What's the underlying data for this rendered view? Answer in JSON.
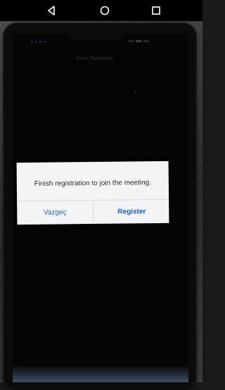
{
  "navbar": {
    "back_icon": "triangle-back-icon",
    "home_icon": "circle-home-icon",
    "recent_icon": "square-recent-icon"
  },
  "phone_screen": {
    "title": "Zoom Toplantıları"
  },
  "dialog": {
    "message": "Finish registration to join the meeting.",
    "cancel_label": "Vazgeç",
    "register_label": "Register"
  },
  "colors": {
    "accent": "#1f5fbf",
    "dialog_bg": "#f4f4f6"
  }
}
